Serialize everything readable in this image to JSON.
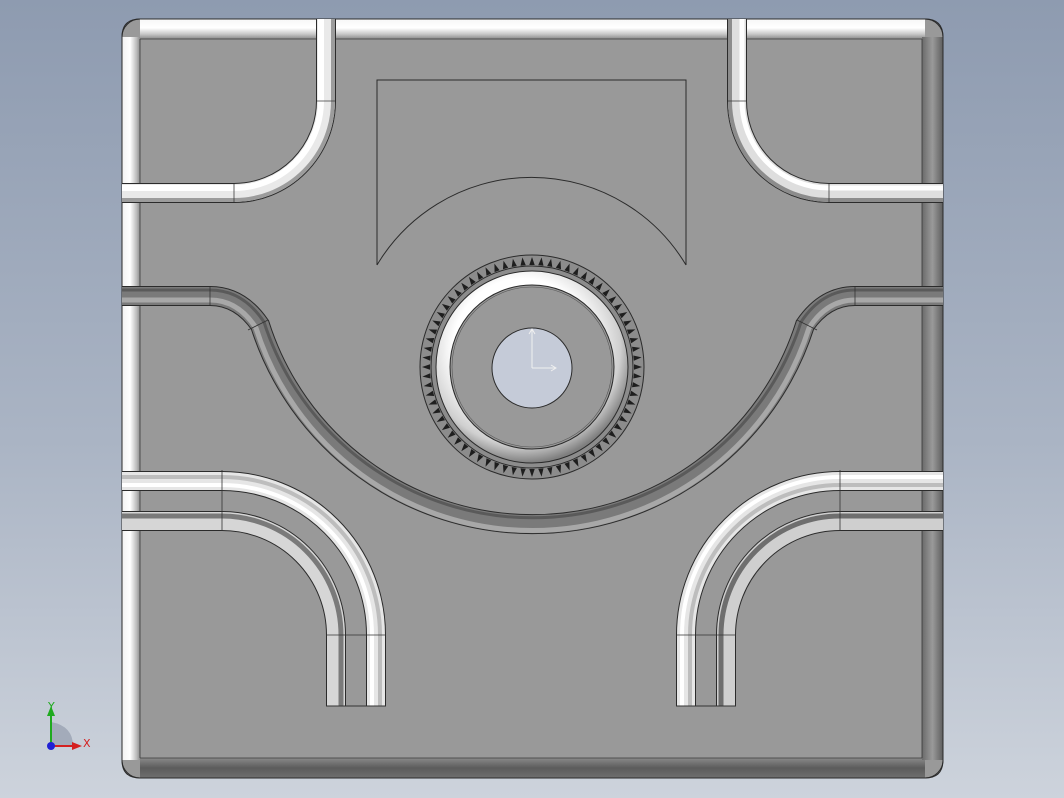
{
  "viewport": {
    "background_top": "#8e9bb0",
    "background_bottom": "#cdd3dc",
    "part_color": "#999999",
    "edge_color": "#2b2b2b"
  },
  "triad": {
    "x_label": "X",
    "y_label": "Y",
    "x_color": "#d42020",
    "y_color": "#1faa1f",
    "z_color": "#2020d4"
  },
  "origin_marker": {
    "icon": "origin-axes-icon"
  }
}
